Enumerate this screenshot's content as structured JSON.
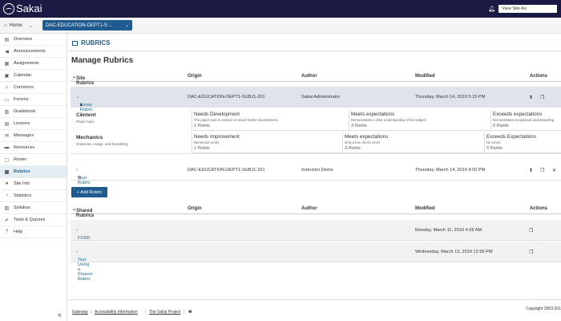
{
  "app": {
    "name": "Sakai",
    "view_site_as": "View Site As:"
  },
  "sitebar": {
    "home": "Home",
    "site": "DAC-EDUCATION-DEPT1-S ..."
  },
  "sidebar": {
    "items": [
      {
        "label": "Overview",
        "icon": "overview-icon",
        "glyph": "▤"
      },
      {
        "label": "Announcements",
        "icon": "megaphone-icon",
        "glyph": "◀"
      },
      {
        "label": "Assignments",
        "icon": "assignment-icon",
        "glyph": "▦"
      },
      {
        "label": "Calendar",
        "icon": "calendar-icon",
        "glyph": "▣"
      },
      {
        "label": "Commons",
        "icon": "commons-icon",
        "glyph": "⌂"
      },
      {
        "label": "Forums",
        "icon": "forums-icon",
        "glyph": "▭"
      },
      {
        "label": "Gradebook",
        "icon": "gradebook-icon",
        "glyph": "▥"
      },
      {
        "label": "Lessons",
        "icon": "lessons-icon",
        "glyph": "▤"
      },
      {
        "label": "Messages",
        "icon": "messages-icon",
        "glyph": "✉"
      },
      {
        "label": "Resources",
        "icon": "folder-icon",
        "glyph": "▬"
      },
      {
        "label": "Roster",
        "icon": "roster-icon",
        "glyph": "▢"
      },
      {
        "label": "Rubrics",
        "icon": "rubrics-icon",
        "glyph": "▦",
        "active": true
      },
      {
        "label": "Site Info",
        "icon": "info-icon",
        "glyph": "●"
      },
      {
        "label": "Statistics",
        "icon": "statistics-icon",
        "glyph": "◔"
      },
      {
        "label": "Syllabus",
        "icon": "syllabus-icon",
        "glyph": "▧"
      },
      {
        "label": "Tests & Quizzes",
        "icon": "check-icon",
        "glyph": "✔"
      },
      {
        "label": "Help",
        "icon": "help-icon",
        "glyph": "?"
      }
    ]
  },
  "tool": {
    "title": "RUBRICS",
    "page_title": "Manage Rubrics"
  },
  "site_rubrics": {
    "headers": {
      "name": "Site Rubrics",
      "origin": "Origin",
      "author": "Author",
      "modified": "Modified",
      "actions": "Actions"
    },
    "rows": [
      {
        "name": "Essay Rubric 1",
        "origin": "DAC-EDUCATION-DEPT1-SUBJ1-201",
        "author": "Sakai Administrator",
        "modified": "Thursday, March 14, 2019 5:15 PM"
      },
      {
        "name": "Quiz Rubric",
        "origin": "DAC-EDUCATION-DEPT1-SUBJ1-201",
        "author": "Instructor Demo",
        "modified": "Thursday, March 14, 2019 4:50 PM"
      }
    ]
  },
  "criteria": [
    {
      "name": "Content",
      "desc": "Paper topic",
      "ratings": [
        {
          "title": "Needs Development",
          "desc": "The paper topic is unclear or needs further development.",
          "points": "1 Points"
        },
        {
          "title": "Meets expectations",
          "desc": "Demonstrates a clear understanding of the subject.",
          "points": "3 Points"
        },
        {
          "title": "Exceeds expectations",
          "desc": "Demonstrates exceptional understanding",
          "points": "5 Points"
        }
      ]
    },
    {
      "name": "Mechanics",
      "desc": "Grammar, usage, and formatting",
      "ratings": [
        {
          "title": "Needs Improvement",
          "desc": "Numerous errors",
          "points": "1 Points"
        },
        {
          "title": "Meets expectations",
          "desc": "Only a few, minor errors",
          "points": "3 Points"
        },
        {
          "title": "Exceeds Expectations",
          "desc": "No errors",
          "points": "5 Points"
        }
      ]
    }
  ],
  "add_button": "+ Add Rubric",
  "shared_rubrics": {
    "headers": {
      "name": "Shared Rubrics",
      "origin": "Origin",
      "author": "Author",
      "modified": "Modified",
      "actions": "Actions"
    },
    "rows": [
      {
        "name": "FORD",
        "modified": "Monday, March 11, 2019 4:28 AM"
      },
      {
        "name": "Test Using a Shared Rubric",
        "modified": "Wednesday, March 13, 2019 12:56 PM"
      }
    ]
  },
  "footer": {
    "links": [
      "Gateway",
      "Accessibility Information",
      "The Sakai Project"
    ],
    "copyright": "Copyright 2003-201"
  },
  "colors": {
    "topbar": "#1a1a44",
    "accent": "#1f5b8e",
    "link": "#1f6e9c",
    "selected_row": "#dfe3eb"
  }
}
